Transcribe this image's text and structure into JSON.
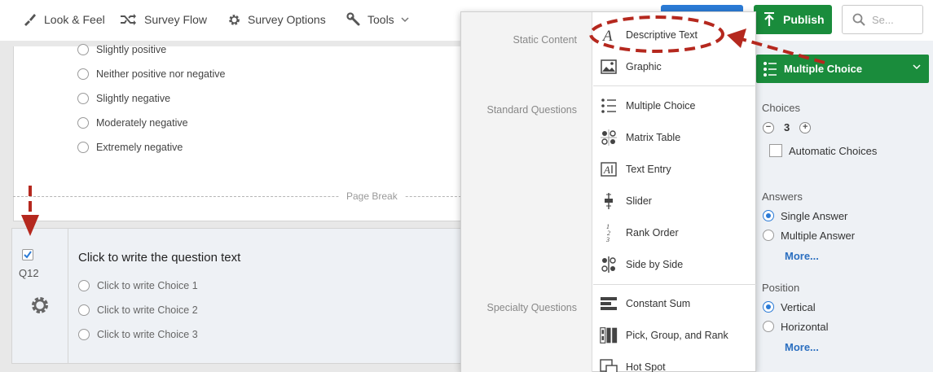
{
  "toolbar": {
    "look_feel": "Look & Feel",
    "survey_flow": "Survey Flow",
    "survey_options": "Survey Options",
    "tools": "Tools",
    "publish": "Publish",
    "search_placeholder": "Se..."
  },
  "survey": {
    "prev_choices": [
      "Slightly positive",
      "Neither positive nor negative",
      "Slightly negative",
      "Moderately negative",
      "Extremely negative"
    ],
    "page_break": "Page Break",
    "q12": {
      "label": "Q12",
      "title": "Click to write the question text",
      "choices": [
        "Click to write Choice 1",
        "Click to write Choice 2",
        "Click to write Choice 3"
      ]
    }
  },
  "menu": {
    "categories": {
      "static": "Static Content",
      "standard": "Standard Questions",
      "specialty": "Specialty Questions"
    },
    "items": {
      "descriptive_text": "Descriptive Text",
      "graphic": "Graphic",
      "multiple_choice": "Multiple Choice",
      "matrix_table": "Matrix Table",
      "text_entry": "Text Entry",
      "slider": "Slider",
      "rank_order": "Rank Order",
      "side_by_side": "Side by Side",
      "constant_sum": "Constant Sum",
      "pick_group_rank": "Pick, Group, and Rank",
      "hot_spot": "Hot Spot"
    }
  },
  "sidebar": {
    "question_type": "Multiple Choice",
    "choices_heading": "Choices",
    "choices_count": "3",
    "automatic_choices": "Automatic Choices",
    "answers_heading": "Answers",
    "single_answer": "Single Answer",
    "multiple_answer": "Multiple Answer",
    "more1": "More...",
    "position_heading": "Position",
    "vertical": "Vertical",
    "horizontal": "Horizontal",
    "more2": "More..."
  },
  "colors": {
    "publish_green": "#1a8c3c",
    "accent_blue": "#2b7bd6",
    "annotation_red": "#b5281e"
  }
}
